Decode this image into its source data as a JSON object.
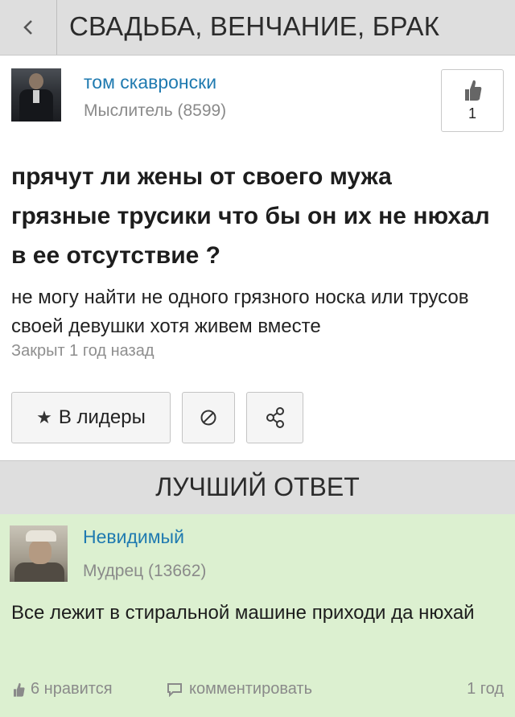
{
  "header": {
    "title": "СВАДЬБА, ВЕНЧАНИЕ, БРАК"
  },
  "question": {
    "author": {
      "name": "том скавронски",
      "rank": "Мыслитель (8599)"
    },
    "like_count": "1",
    "title": "прячут ли жены от своего мужа грязные трусики что бы он их не нюхал в ее отсутствие ?",
    "body": "не могу найти не одного грязного носка или трусов своей девушки хотя живем вместе",
    "status": "Закрыт 1 год назад"
  },
  "actions": {
    "leaders_label": "В лидеры"
  },
  "best_answer": {
    "section_title": "ЛУЧШИЙ ОТВЕТ",
    "author": {
      "name": "Невидимый",
      "rank": "Мудрец (13662)"
    },
    "text": "Все лежит в стиральной машине приходи да нюхай",
    "likes_label": "6 нравится",
    "comment_label": "комментировать",
    "age": "1 год"
  },
  "colors": {
    "link": "#1f7ab0",
    "answer_bg": "#dcf0d0",
    "header_bg": "#dedede"
  }
}
